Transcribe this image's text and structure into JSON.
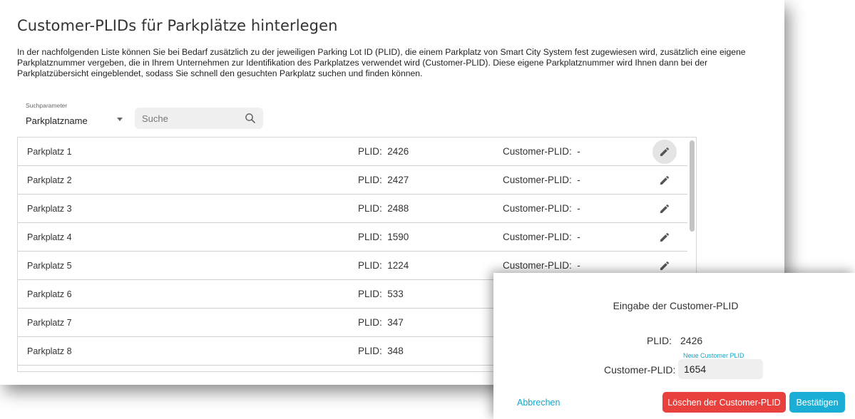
{
  "page": {
    "title": "Customer-PLIDs für Parkplätze hinterlegen",
    "description": "In der nachfolgenden Liste können Sie bei Bedarf zusätzlich zu der jeweiligen Parking Lot ID (PLID), die einem Parkplatz von Smart City System fest zugewiesen wird, zusätzlich eine eigene Parkplatznummer vergeben, die in Ihrem Unternehmen zur Identifikation des Parkplatzes verwendet wird (Customer-PLID). Diese eigene Parkplatznummer wird Ihnen dann bei der Parkplatzübersicht eingeblendet, sodass Sie schnell den gesuchten Parkplatz suchen und finden können."
  },
  "search": {
    "param_label": "Suchparameter",
    "param_value": "Parkplatzname",
    "placeholder": "Suche",
    "icon": "search-icon"
  },
  "list": {
    "rows": [
      {
        "name": "Parkplatz 1",
        "plid_label": "PLID:",
        "plid": "2426",
        "cplid_label": "Customer-PLID:",
        "cplid": "-"
      },
      {
        "name": "Parkplatz 2",
        "plid_label": "PLID:",
        "plid": "2427",
        "cplid_label": "Customer-PLID:",
        "cplid": "-"
      },
      {
        "name": "Parkplatz 3",
        "plid_label": "PLID:",
        "plid": "2488",
        "cplid_label": "Customer-PLID:",
        "cplid": "-"
      },
      {
        "name": "Parkplatz 4",
        "plid_label": "PLID:",
        "plid": "1590",
        "cplid_label": "Customer-PLID:",
        "cplid": "-"
      },
      {
        "name": "Parkplatz 5",
        "plid_label": "PLID:",
        "plid": "1224",
        "cplid_label": "Customer-PLID:",
        "cplid": "-"
      },
      {
        "name": "Parkplatz 6",
        "plid_label": "PLID:",
        "plid": "533",
        "cplid_label": "",
        "cplid": ""
      },
      {
        "name": "Parkplatz 7",
        "plid_label": "PLID:",
        "plid": "347",
        "cplid_label": "",
        "cplid": ""
      },
      {
        "name": "Parkplatz 8",
        "plid_label": "PLID:",
        "plid": "348",
        "cplid_label": "",
        "cplid": ""
      }
    ],
    "edit_icon": "pencil-icon"
  },
  "dialog": {
    "title": "Eingabe der Customer-PLID",
    "plid_label": "PLID:",
    "plid_value": "2426",
    "input_float_label": "Neue Customer PLID",
    "cplid_label": "Customer-PLID:",
    "input_value": "1654",
    "cancel_label": "Abbrechen",
    "delete_label": "Löschen der Customer-PLID",
    "confirm_label": "Bestätigen"
  },
  "colors": {
    "accent": "#16a6c9",
    "confirm": "#1aaed6",
    "danger": "#e8403d"
  }
}
